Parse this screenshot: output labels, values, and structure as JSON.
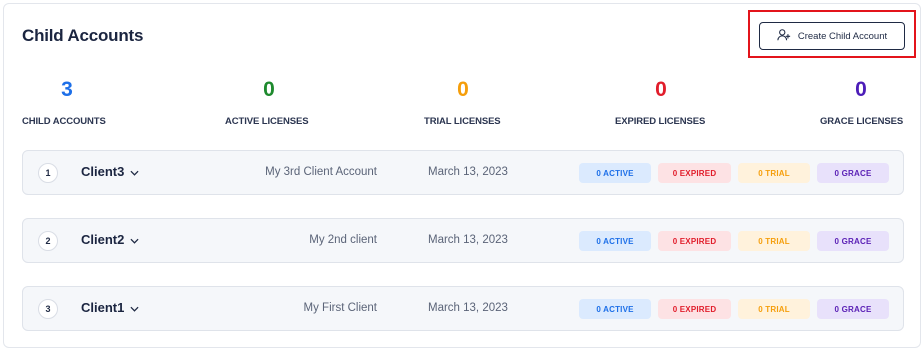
{
  "header": {
    "title": "Child Accounts",
    "create_button_label": "Create Child Account"
  },
  "stats": [
    {
      "value": "3",
      "label": "CHILD ACCOUNTS",
      "color": "#1d6fe8"
    },
    {
      "value": "0",
      "label": "ACTIVE LICENSES",
      "color": "#1e8a2e"
    },
    {
      "value": "0",
      "label": "TRIAL LICENSES",
      "color": "#f59e0b"
    },
    {
      "value": "0",
      "label": "EXPIRED LICENSES",
      "color": "#e11d2b"
    },
    {
      "value": "0",
      "label": "GRACE LICENSES",
      "color": "#4c1db8"
    }
  ],
  "rows": [
    {
      "index": "1",
      "name": "Client3",
      "description": "My 3rd Client Account",
      "date": "March 13, 2023",
      "active": "0 ACTIVE",
      "expired": "0 EXPIRED",
      "trial": "0 TRIAL",
      "grace": "0 GRACE"
    },
    {
      "index": "2",
      "name": "Client2",
      "description": "My 2nd client",
      "date": "March 13, 2023",
      "active": "0 ACTIVE",
      "expired": "0 EXPIRED",
      "trial": "0 TRIAL",
      "grace": "0 GRACE"
    },
    {
      "index": "3",
      "name": "Client1",
      "description": "My First Client",
      "date": "March 13, 2023",
      "active": "0 ACTIVE",
      "expired": "0 EXPIRED",
      "trial": "0 TRIAL",
      "grace": "0 GRACE"
    }
  ],
  "icons": {
    "create": "add-user-icon",
    "expand": "chevron-down-icon"
  }
}
